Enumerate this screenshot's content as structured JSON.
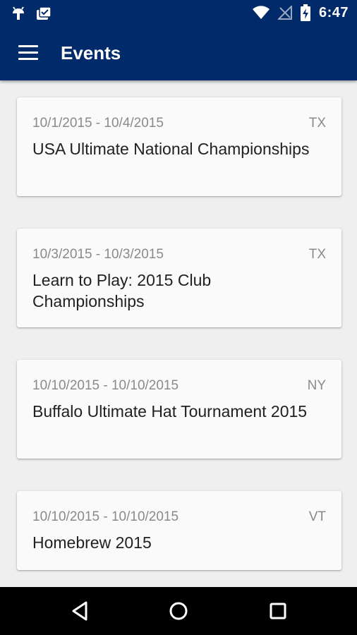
{
  "status_bar": {
    "time": "6:47",
    "icons_left": [
      "android-debug-icon",
      "clipboard-check-icon"
    ],
    "icons_right": [
      "wifi-icon",
      "no-signal-icon",
      "battery-charging-icon"
    ]
  },
  "app_bar": {
    "title": "Events",
    "menu_icon": "menu-icon",
    "color": "#002a6a"
  },
  "events": [
    {
      "dates": "10/1/2015 - 10/4/2015",
      "state": "TX",
      "name": "USA Ultimate National Championships"
    },
    {
      "dates": "10/3/2015 - 10/3/2015",
      "state": "TX",
      "name": "Learn to Play: 2015 Club Championships"
    },
    {
      "dates": "10/10/2015 - 10/10/2015",
      "state": "NY",
      "name": "Buffalo Ultimate Hat Tournament 2015"
    },
    {
      "dates": "10/10/2015 - 10/10/2015",
      "state": "VT",
      "name": "Homebrew 2015"
    }
  ],
  "nav_bar": {
    "buttons": [
      "back-icon",
      "home-icon",
      "recents-icon"
    ]
  }
}
